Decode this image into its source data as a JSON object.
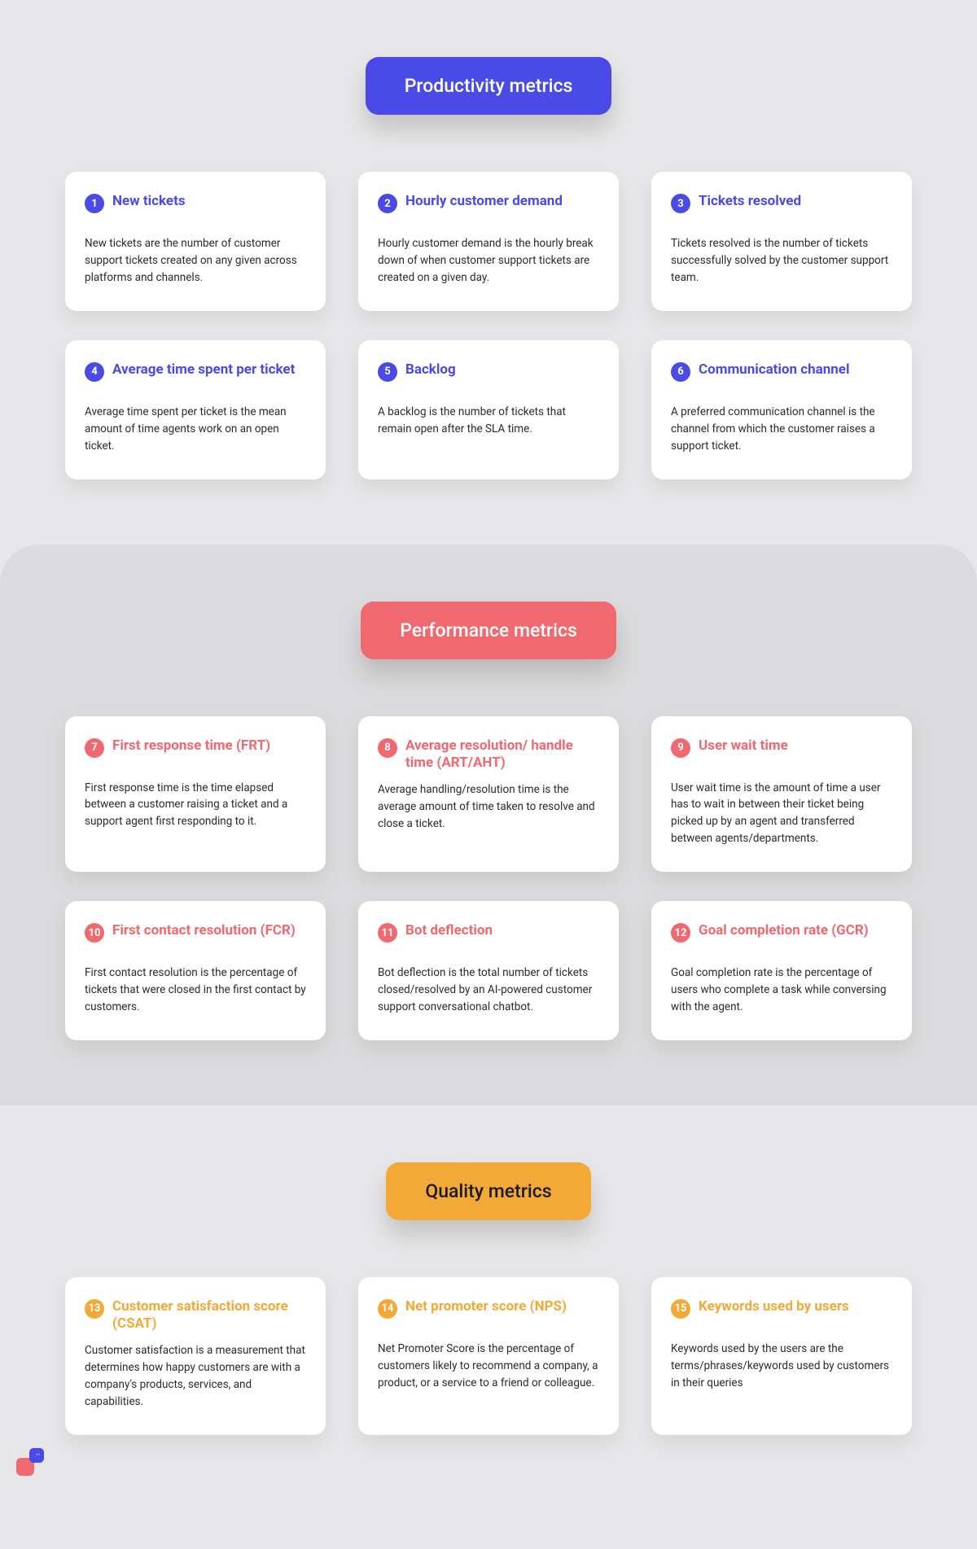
{
  "sections": [
    {
      "id": "productivity",
      "pillClass": "pill-blue",
      "badgeClass": "badge-blue",
      "titleClass": "title-blue",
      "sectionClass": "section-1",
      "heading": "Productivity metrics",
      "cards": [
        {
          "num": "1",
          "title": "New tickets",
          "desc": "New tickets are the number of customer support tickets created on any given across platforms and channels."
        },
        {
          "num": "2",
          "title": "Hourly customer demand",
          "desc": "Hourly customer demand is the hourly break down of when customer support tickets are created on a given day."
        },
        {
          "num": "3",
          "title": "Tickets resolved",
          "desc": "Tickets resolved is the number of tickets successfully solved by the customer support team."
        },
        {
          "num": "4",
          "title": "Average time spent per ticket",
          "desc": "Average time spent per ticket is the mean amount of time agents work on an open ticket."
        },
        {
          "num": "5",
          "title": "Backlog",
          "desc": "A backlog is the number of tickets that remain open after the SLA time."
        },
        {
          "num": "6",
          "title": "Communication channel",
          "desc": "A preferred communication channel is the channel from which the customer raises a support ticket."
        }
      ]
    },
    {
      "id": "performance",
      "pillClass": "pill-red",
      "badgeClass": "badge-red",
      "titleClass": "title-red",
      "sectionClass": "section-2 section-rounded",
      "heading": "Performance metrics",
      "cards": [
        {
          "num": "7",
          "title": "First response time (FRT)",
          "desc": "First response time is the time elapsed between a customer raising a ticket and a support agent first responding to it."
        },
        {
          "num": "8",
          "title": "Average resolution/ handle time (ART/AHT)",
          "desc": "Average handling/resolution time is the average amount of time taken to resolve and close a ticket."
        },
        {
          "num": "9",
          "title": "User wait time",
          "desc": "User wait time is the amount of time a user has to wait in between their ticket being picked up by an agent and transferred between agents/departments."
        },
        {
          "num": "10",
          "title": "First contact resolution (FCR)",
          "desc": "First contact resolution is the percentage of tickets that were closed in the first contact by customers."
        },
        {
          "num": "11",
          "title": "Bot deflection",
          "desc": "Bot deflection is the total number of tickets closed/resolved by an AI-powered customer support conversational chatbot."
        },
        {
          "num": "12",
          "title": "Goal completion rate (GCR)",
          "desc": "Goal completion rate is the percentage of users who complete a task while conversing with the agent."
        }
      ]
    },
    {
      "id": "quality",
      "pillClass": "pill-yellow",
      "badgeClass": "badge-yellow",
      "titleClass": "title-yellow",
      "sectionClass": "section-3 section-rounded",
      "heading": "Quality metrics",
      "cards": [
        {
          "num": "13",
          "title": "Customer satisfaction score (CSAT)",
          "desc": "Customer satisfaction is a measurement that determines how happy customers are with a company's products, services, and capabilities."
        },
        {
          "num": "14",
          "title": "Net promoter score (NPS)",
          "desc": "Net Promoter Score is the percentage of customers likely to recommend a company, a product, or a service to a friend or colleague."
        },
        {
          "num": "15",
          "title": "Keywords used by users",
          "desc": "Keywords used by the users are the terms/phrases/keywords used by customers in their queries"
        }
      ]
    }
  ]
}
